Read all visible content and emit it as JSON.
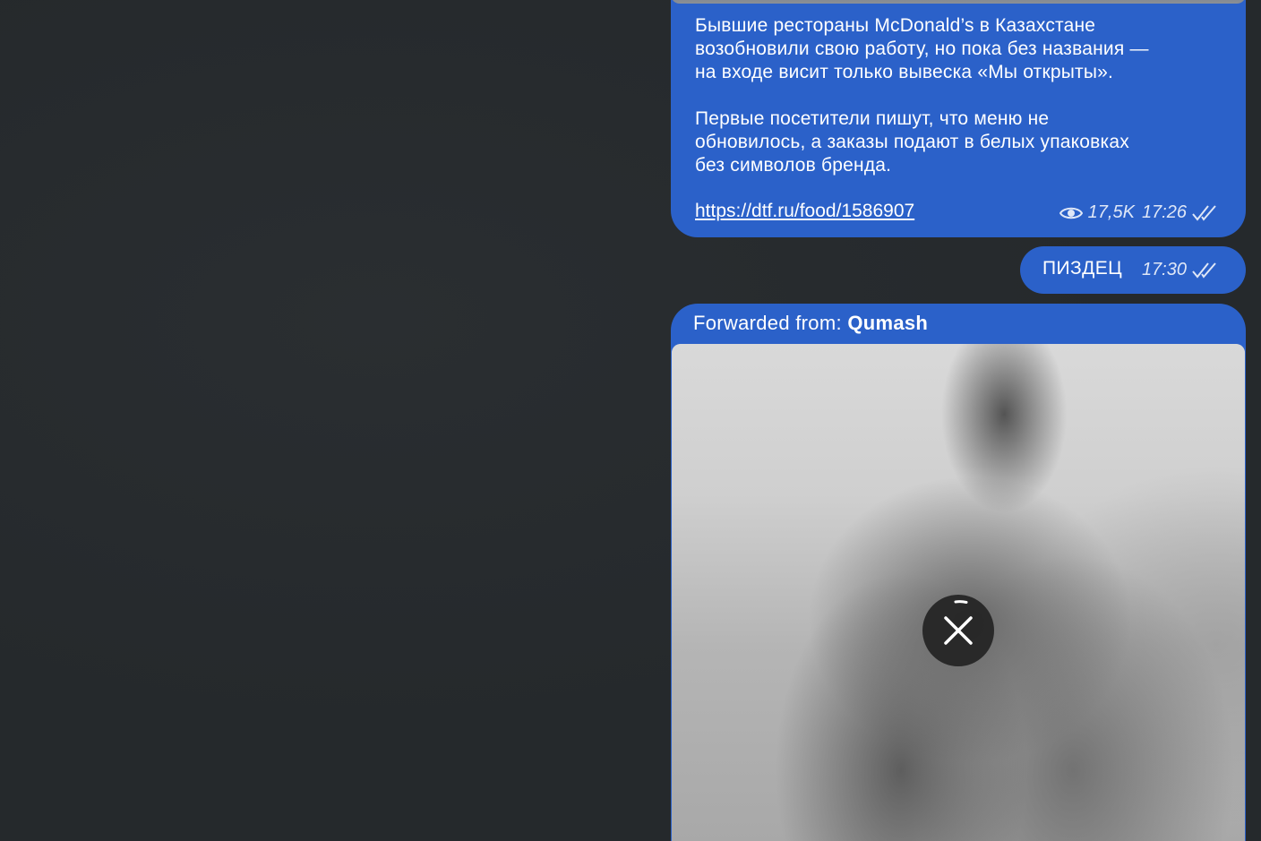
{
  "messages": {
    "post": {
      "text": "Бывшие рестораны McDonald’s в Казахстане\nвозобновили свою работу, но пока без названия —\nна входе висит только вывеска «Мы открыты».\n\nПервые посетители пишут, что меню не\nобновилось, а заказы подают в белых упаковках\nбез символов бренда.",
      "link": "https://dtf.ru/food/1586907",
      "views": "17,5K",
      "time": "17:26"
    },
    "short": {
      "text": "ПИЗДЕЦ",
      "time": "17:30"
    },
    "forwarded": {
      "label": "Forwarded from:",
      "source": "Qumash"
    }
  },
  "icons": {
    "views": "eye-icon",
    "read_status": "double-check-icon",
    "cancel_download": "close-icon"
  },
  "colors": {
    "bubble": "#2b61c9",
    "background": "#25292c"
  }
}
